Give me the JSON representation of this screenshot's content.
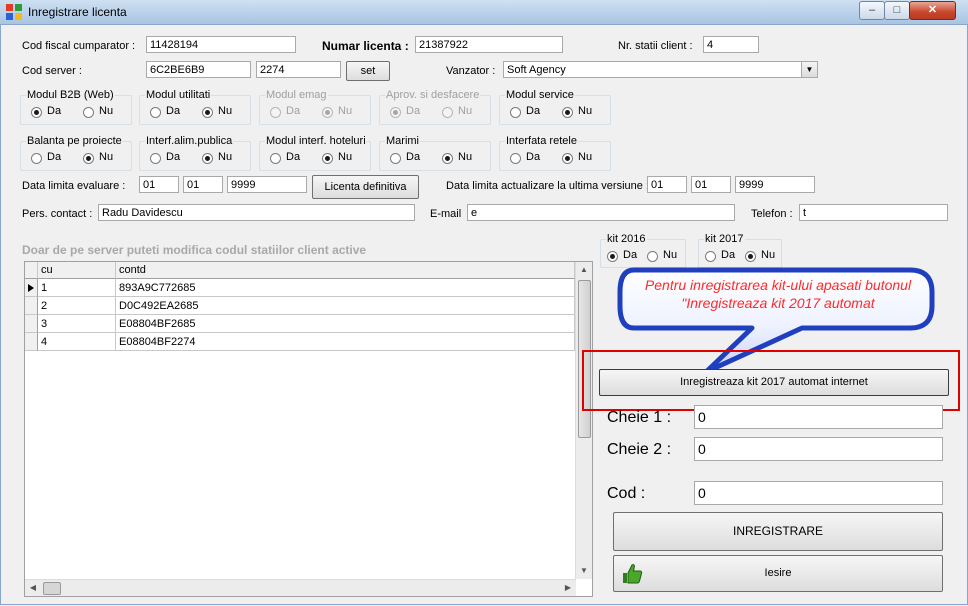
{
  "window": {
    "title": "Inregistrare licenta",
    "min": "–",
    "max": "□",
    "close": "✕"
  },
  "form": {
    "cod_fiscal_label": "Cod fiscal cumparator :",
    "cod_fiscal_value": "11428194",
    "numar_licenta_label": "Numar licenta :",
    "numar_licenta_value": "21387922",
    "nr_statii_label": "Nr. statii client :",
    "nr_statii_value": "4",
    "cod_server_label": "Cod server :",
    "cod_server_value1": "6C2BE6B9",
    "cod_server_value2": "2274",
    "set_button": "set",
    "vanzator_label": "Vanzator :",
    "vanzator_value": "Soft Agency",
    "data_limita_eval_label": "Data limita evaluare :",
    "eval_day": "01",
    "eval_month": "01",
    "eval_year": "9999",
    "licenta_definitiva_button": "Licenta definitiva",
    "data_limita_act_label": "Data limita actualizare la ultima versiune :",
    "act_day": "01",
    "act_month": "01",
    "act_year": "9999",
    "pers_contact_label": "Pers. contact :",
    "pers_contact_value": "Radu Davidescu",
    "email_label": "E-mail",
    "email_value": "e",
    "telefon_label": "Telefon :",
    "telefon_value": "t"
  },
  "option_da": "Da",
  "option_nu": "Nu",
  "modules": [
    {
      "title": "Modul B2B (Web)",
      "selected": "da",
      "disabled": false
    },
    {
      "title": "Modul utilitati",
      "selected": "nu",
      "disabled": false
    },
    {
      "title": "Modul emag",
      "selected": "nu",
      "disabled": true
    },
    {
      "title": "Aprov. si desfacere",
      "selected": "da",
      "disabled": true
    },
    {
      "title": "Modul service",
      "selected": "nu",
      "disabled": false
    },
    {
      "title": "Balanta pe proiecte",
      "selected": "nu",
      "disabled": false
    },
    {
      "title": "Interf.alim.publica",
      "selected": "nu",
      "disabled": false
    },
    {
      "title": "Modul interf. hoteluri",
      "selected": "nu",
      "disabled": false
    },
    {
      "title": "Marimi",
      "selected": "nu",
      "disabled": false
    },
    {
      "title": "Interfata retele",
      "selected": "nu",
      "disabled": false
    }
  ],
  "kits": [
    {
      "title": "kit 2016",
      "selected": "da"
    },
    {
      "title": "kit 2017",
      "selected": "nu"
    }
  ],
  "grid": {
    "caption": "Doar de pe server puteti modifica codul statiilor client active",
    "columns": [
      "cu",
      "contd"
    ],
    "rows": [
      [
        "1",
        "893A9C772685"
      ],
      [
        "2",
        "D0C492EA2685"
      ],
      [
        "3",
        "E08804BF2685"
      ],
      [
        "4",
        "E08804BF2274"
      ]
    ]
  },
  "callout": {
    "text": "Pentru inregistrarea kit-ului apasati butonul \"Inregistreaza kit 2017 automat"
  },
  "register_panel": {
    "auto_button": "Inregistreaza kit 2017 automat internet",
    "cheie1_label": "Cheie 1 :",
    "cheie1_value": "0",
    "cheie2_label": "Cheie 2 :",
    "cheie2_value": "0",
    "cod_label": "Cod :",
    "cod_value": "0",
    "inregistrare_button": "INREGISTRARE",
    "iesire_button": "Iesire"
  },
  "colors": {
    "callout_fill": "#1f3fbf",
    "callout_text": "#ff2a2a",
    "highlight_border": "#e00000"
  }
}
